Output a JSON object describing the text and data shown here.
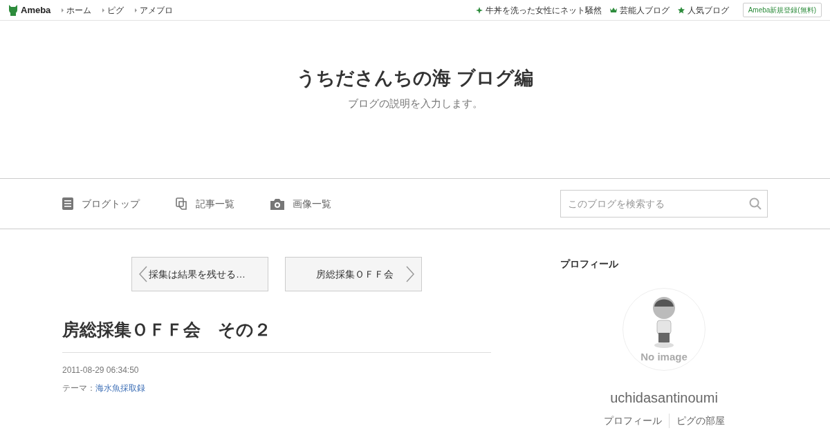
{
  "topbar": {
    "logo": "Ameba",
    "links": [
      "ホーム",
      "ピグ",
      "アメブロ"
    ],
    "right_links": [
      {
        "kind": "sparkle",
        "label": "牛丼を洗った女性にネット騒然"
      },
      {
        "kind": "crown",
        "label": "芸能人ブログ"
      },
      {
        "kind": "star",
        "label": "人気ブログ"
      }
    ],
    "register_button": "Ameba新規登録(無料)"
  },
  "header": {
    "title": "うちださんちの海 ブログ編",
    "description": "ブログの説明を入力します。"
  },
  "nav": {
    "items": [
      {
        "kind": "doc",
        "label": "ブログトップ"
      },
      {
        "kind": "copy",
        "label": "記事一覧"
      },
      {
        "kind": "camera",
        "label": "画像一覧"
      }
    ],
    "search": {
      "placeholder": "このブログを検索する"
    }
  },
  "pager": {
    "prev": "採集は結果を残せる…",
    "next": "房総採集ＯＦＦ会"
  },
  "article": {
    "title": "房総採集ＯＦＦ会　その２",
    "date": "2011-08-29 06:34:50",
    "theme_label": "テーマ：",
    "theme": "海水魚採取録"
  },
  "profile": {
    "heading": "プロフィール",
    "avatar_caption": "No image",
    "name": "uchidasantinoumi",
    "links": [
      "プロフィール",
      "ピグの部屋"
    ]
  }
}
